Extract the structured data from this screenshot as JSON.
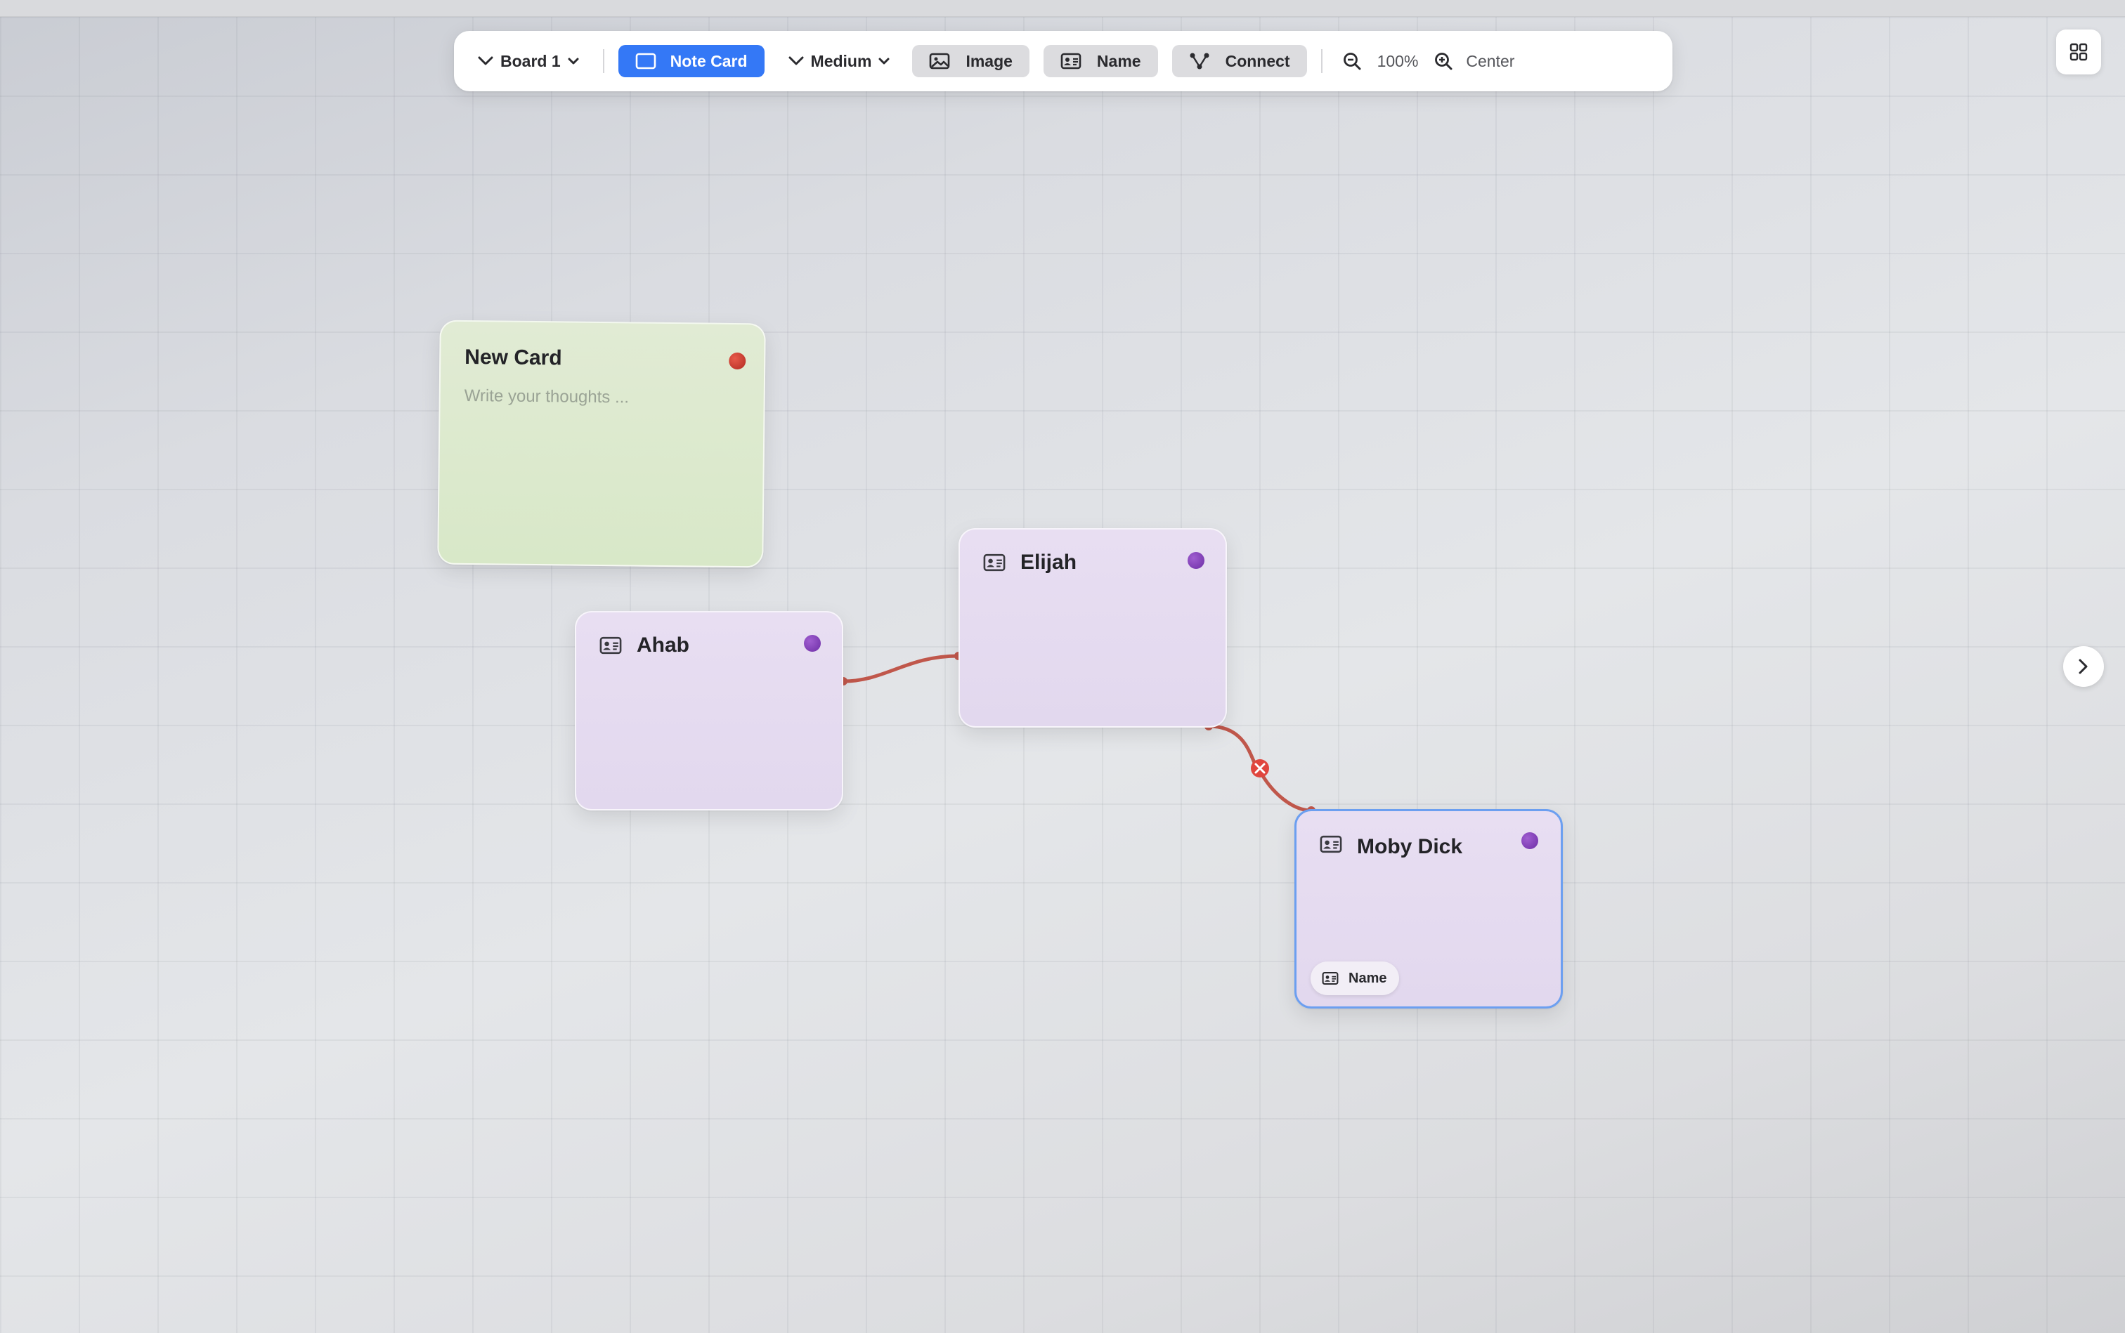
{
  "toolbar": {
    "board_label": "Board 1",
    "note_card_label": "Note Card",
    "size_label": "Medium",
    "image_label": "Image",
    "name_label": "Name",
    "connect_label": "Connect",
    "zoom_level": "100%",
    "center_label": "Center",
    "accent_color": "#3478f6"
  },
  "cards": {
    "note": {
      "title": "New Card",
      "placeholder": "Write your thoughts ...",
      "dot_color": "#c0392b"
    },
    "ahab": {
      "title": "Ahab",
      "dot_color": "#8e44ad"
    },
    "elijah": {
      "title": "Elijah",
      "dot_color": "#8e44ad"
    },
    "moby": {
      "title": "Moby Dick",
      "dot_color": "#8e44ad",
      "chip_label": "Name"
    }
  },
  "connections": [
    {
      "from": "Ahab",
      "to": "Elijah",
      "color": "#c0574b"
    },
    {
      "from": "Elijah",
      "to": "Moby Dick",
      "color": "#c0574b",
      "has_delete_marker": true
    }
  ],
  "icons": {
    "grid_button": "grid-icon",
    "next_button": "chevron-right-icon"
  }
}
